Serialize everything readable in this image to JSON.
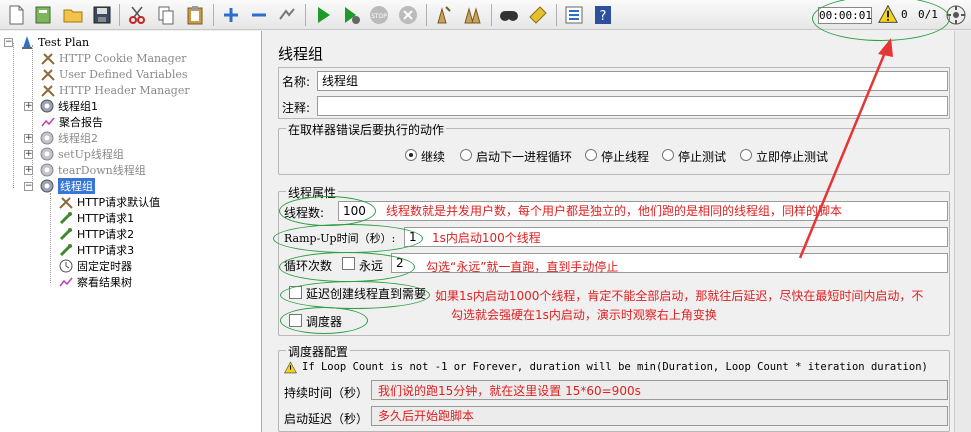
{
  "toolbar": {
    "timer": "00:00:01",
    "warning_count": "0",
    "threads": "0/1",
    "icons": [
      "new-icon",
      "templates-icon",
      "open-icon",
      "save-icon",
      "cut-icon",
      "copy-icon",
      "paste-icon",
      "expand-icon",
      "collapse-icon",
      "toggle-icon",
      "start-icon",
      "start-no-pause-icon",
      "stop-icon",
      "shutdown-icon",
      "clear-icon",
      "clear-all-icon",
      "search-icon",
      "reset-search-icon",
      "function-helper-icon",
      "help-icon",
      "warning-icon",
      "remote-icon"
    ]
  },
  "tree": {
    "items": [
      {
        "label": "Test Plan"
      },
      {
        "label": "HTTP Cookie Manager"
      },
      {
        "label": "User Defined Variables"
      },
      {
        "label": "HTTP Header Manager"
      },
      {
        "label": "线程组1"
      },
      {
        "label": "聚合报告"
      },
      {
        "label": "线程组2"
      },
      {
        "label": "setUp线程组"
      },
      {
        "label": "tearDown线程组"
      },
      {
        "label": "线程组"
      },
      {
        "label": "HTTP请求默认值"
      },
      {
        "label": "HTTP请求1"
      },
      {
        "label": "HTTP请求2"
      },
      {
        "label": "HTTP请求3"
      },
      {
        "label": "固定定时器"
      },
      {
        "label": "察看结果树"
      }
    ]
  },
  "panel": {
    "title": "线程组",
    "name_label": "名称:",
    "name_value": "线程组",
    "comment_label": "注释:",
    "comment_value": "",
    "on_error": {
      "title": "在取样器错误后要执行的动作",
      "options": [
        "继续",
        "启动下一进程循环",
        "停止线程",
        "停止测试",
        "立即停止测试"
      ],
      "selected": "继续"
    },
    "thread_props": {
      "title": "线程属性",
      "threads_label": "线程数:",
      "threads_value": "100",
      "rampup_label": "Ramp-Up时间（秒）:",
      "rampup_value": "1",
      "loop_label": "循环次数",
      "forever_label": "永远",
      "loop_value": "2",
      "delay_label": "延迟创建线程直到需要",
      "scheduler_label": "调度器"
    },
    "scheduler": {
      "title": "调度器配置",
      "warning": "If Loop Count is not -1 or Forever, duration will be min(Duration, Loop Count * iteration duration)",
      "duration_label": "持续时间（秒）",
      "delay_label": "启动延迟（秒）"
    }
  },
  "annotations": {
    "threads_note": "线程数就是并发用户数，每个用户都是独立的，他们跑的是相同的线程组，同样的脚本",
    "rampup_note": "1s内启动100个线程",
    "forever_note": "勾选“永远”就一直跑，直到手动停止",
    "delay_note_1": "如果1s内启动1000个线程，肯定不能全部启动，那就往后延迟，尽快在最短时间内启动，不",
    "delay_note_2": "勾选就会强硬在1s内启动，演示时观察右上角变换",
    "duration_note": "我们说的跑15分钟，就在这里设置 15*60=900s",
    "start_delay_note": "多久后开始跑脚本"
  },
  "colors": {
    "annotation": "#e02020",
    "circle": "#2f9e44",
    "selection": "#3875d7"
  }
}
